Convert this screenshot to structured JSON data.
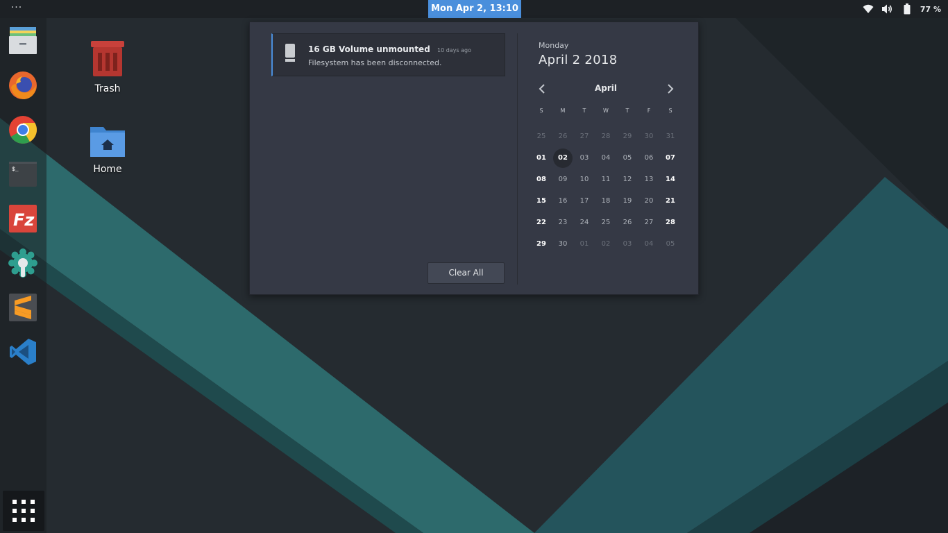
{
  "topbar": {
    "activities_label": "···",
    "clock": "Mon Apr  2, 13:10",
    "battery_percent": "77 %",
    "icons": [
      "wifi-icon",
      "volume-icon",
      "battery-icon"
    ]
  },
  "dock": {
    "apps": [
      "files",
      "firefox",
      "chrome",
      "terminal",
      "filezilla",
      "settings-tweaks",
      "sublime-text",
      "visual-studio-code"
    ],
    "show_apps_icon": "app-grid-icon"
  },
  "desktop": {
    "trash_label": "Trash",
    "home_label": "Home"
  },
  "notification": {
    "title": "16 GB Volume unmounted",
    "time": "10 days ago",
    "body": "Filesystem has been disconnected.",
    "icon": "drive-icon"
  },
  "clear_all_label": "Clear All",
  "calendar": {
    "weekday": "Monday",
    "date": "April  2 2018",
    "month": "April",
    "day_headers": [
      "S",
      "M",
      "T",
      "W",
      "T",
      "F",
      "S"
    ],
    "weeks": [
      [
        "25",
        "26",
        "27",
        "28",
        "29",
        "30",
        "31"
      ],
      [
        "01",
        "02",
        "03",
        "04",
        "05",
        "06",
        "07"
      ],
      [
        "08",
        "09",
        "10",
        "11",
        "12",
        "13",
        "14"
      ],
      [
        "15",
        "16",
        "17",
        "18",
        "19",
        "20",
        "21"
      ],
      [
        "22",
        "23",
        "24",
        "25",
        "26",
        "27",
        "28"
      ],
      [
        "29",
        "30",
        "01",
        "02",
        "03",
        "04",
        "05"
      ]
    ],
    "selected_day": "02"
  },
  "colors": {
    "accent": "#4a8fdc",
    "panel": "#353945",
    "teal": "#2f6b70"
  }
}
